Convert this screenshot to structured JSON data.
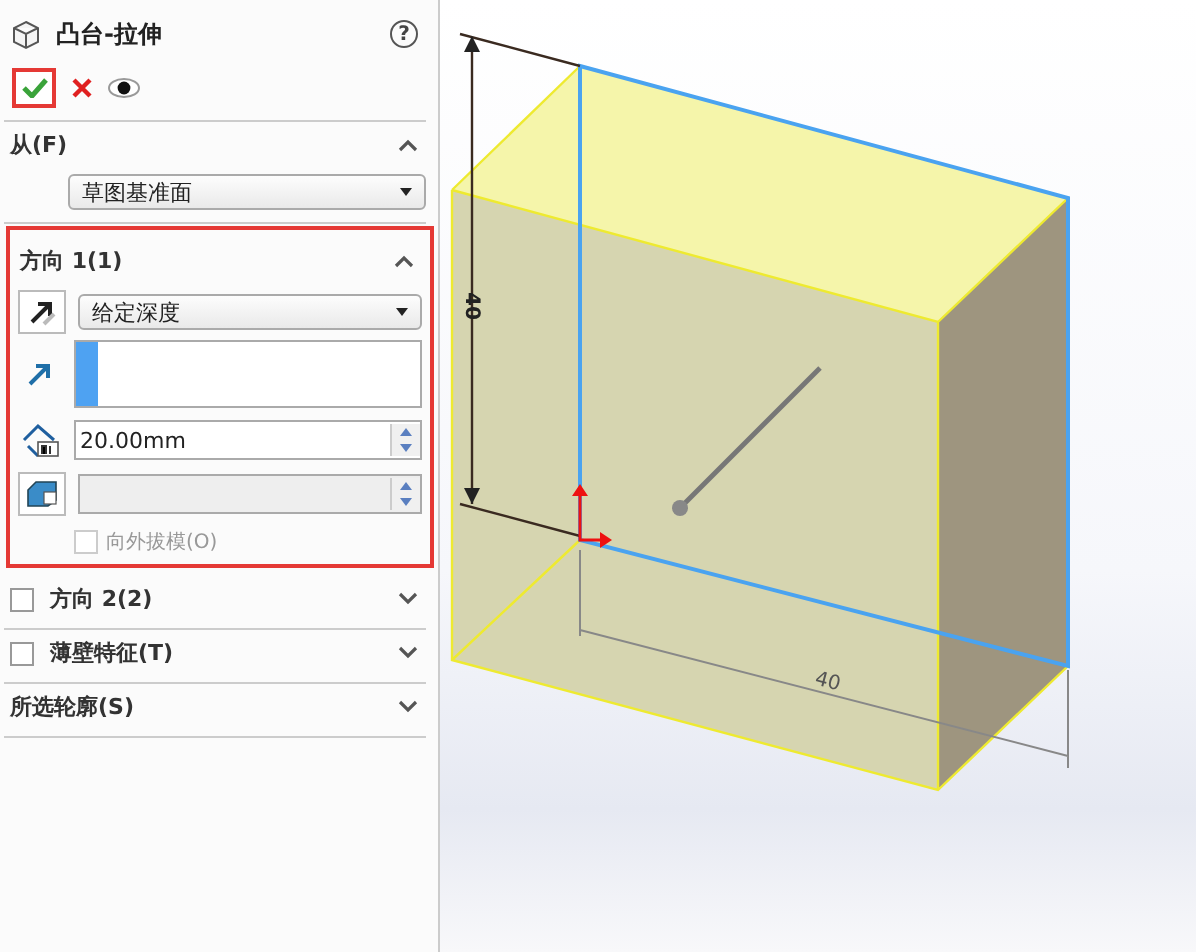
{
  "feature": {
    "title": "凸台-拉伸",
    "help": "?"
  },
  "sections": [
    {
      "kind": "from",
      "title": "从(F)",
      "expanded": true,
      "dropdown": "草图基准面"
    },
    {
      "kind": "direction",
      "title": "方向 1(1)",
      "expanded": true,
      "highlighted": true,
      "end_condition": "给定深度",
      "depth": "20.00mm",
      "draft": {
        "label": "向外拔模(O)",
        "checked": false,
        "disabled": true
      }
    },
    {
      "kind": "toggle",
      "title": "方向 2(2)",
      "checked": false,
      "expanded": false
    },
    {
      "kind": "toggle",
      "title": "薄壁特征(T)",
      "checked": false,
      "expanded": false
    },
    {
      "kind": "plain",
      "title": "所选轮廓(S)",
      "expanded": false
    }
  ],
  "viewport": {
    "dimension_vertical": "40",
    "dimension_horizontal": "40"
  }
}
